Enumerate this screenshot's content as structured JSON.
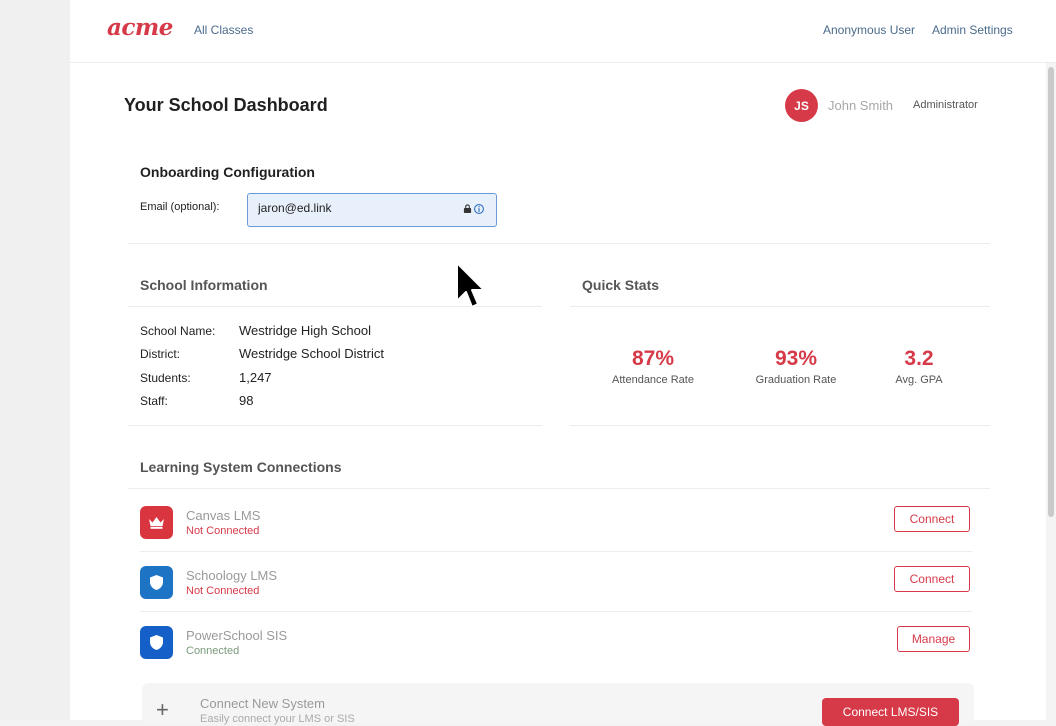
{
  "header": {
    "logo": "acme",
    "all_classes": "All Classes",
    "anonymous_user": "Anonymous User",
    "admin_settings": "Admin Settings"
  },
  "page": {
    "title": "Your School Dashboard",
    "user": {
      "initials": "JS",
      "name": "John Smith",
      "role": "Administrator"
    }
  },
  "onboarding": {
    "title": "Onboarding Configuration",
    "email_label": "Email (optional):",
    "email_value": "jaron@ed.link"
  },
  "school_info": {
    "title": "School Information",
    "rows": [
      {
        "label": "School Name:",
        "value": "Westridge High School"
      },
      {
        "label": "District:",
        "value": "Westridge School District"
      },
      {
        "label": "Students:",
        "value": "1,247"
      },
      {
        "label": "Staff:",
        "value": "98"
      }
    ]
  },
  "quick_stats": {
    "title": "Quick Stats",
    "items": [
      {
        "value": "87%",
        "label": "Attendance Rate"
      },
      {
        "value": "93%",
        "label": "Graduation Rate"
      },
      {
        "value": "3.2",
        "label": "Avg. GPA"
      }
    ]
  },
  "connections": {
    "title": "Learning System Connections",
    "items": [
      {
        "name": "Canvas LMS",
        "status": "Not Connected",
        "button": "Connect",
        "icon": "crown-icon",
        "color": "#d9353f",
        "status_color": "#d63a48"
      },
      {
        "name": "Schoology LMS",
        "status": "Not Connected",
        "button": "Connect",
        "icon": "shield-icon",
        "color": "#1d73c4",
        "status_color": "#d63a48"
      },
      {
        "name": "PowerSchool SIS",
        "status": "Connected",
        "button": "Manage",
        "icon": "shield-icon",
        "color": "#1560c8",
        "status_color": "#7a9a7a"
      }
    ],
    "new_system": {
      "title": "Connect New System",
      "subtitle": "Easily connect your LMS or SIS",
      "button": "Connect LMS/SIS"
    }
  },
  "colors": {
    "accent": "#d63a48",
    "link": "#4b6b8c"
  }
}
